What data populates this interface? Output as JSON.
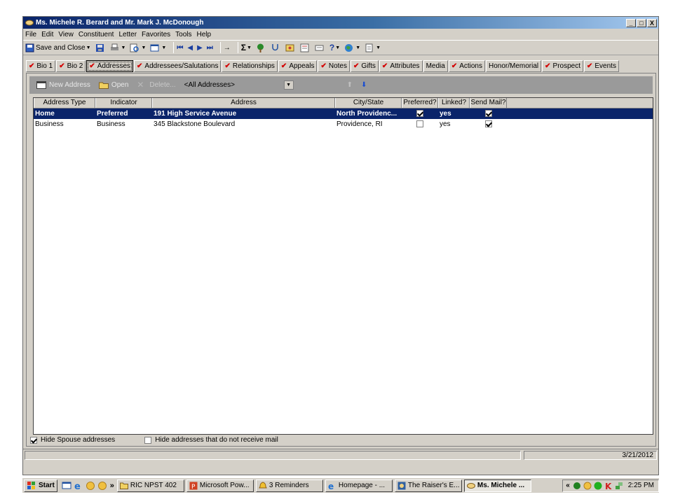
{
  "window": {
    "title": "Ms. Michele R. Berard and Mr. Mark J. McDonough",
    "controls": {
      "minimize": "_",
      "maximize": "□",
      "close": "X"
    }
  },
  "menu": [
    "File",
    "Edit",
    "View",
    "Constituent",
    "Letter",
    "Favorites",
    "Tools",
    "Help"
  ],
  "toolbar": {
    "save_close_label": "Save and Close"
  },
  "tabs": [
    {
      "label": "Bio 1",
      "checked": true
    },
    {
      "label": "Bio 2",
      "checked": true
    },
    {
      "label": "Addresses",
      "checked": true,
      "active": true
    },
    {
      "label": "Addressees/Salutations",
      "checked": true
    },
    {
      "label": "Relationships",
      "checked": true
    },
    {
      "label": "Appeals",
      "checked": true
    },
    {
      "label": "Notes",
      "checked": true
    },
    {
      "label": "Gifts",
      "checked": true
    },
    {
      "label": "Attributes",
      "checked": true
    },
    {
      "label": "Media",
      "checked": false
    },
    {
      "label": "Actions",
      "checked": true
    },
    {
      "label": "Honor/Memorial",
      "checked": false
    },
    {
      "label": "Prospect",
      "checked": true
    },
    {
      "label": "Events",
      "checked": true
    }
  ],
  "address_toolbar": {
    "new_label": "New Address",
    "open_label": "Open",
    "delete_label": "Delete...",
    "filter_value": "<All Addresses>"
  },
  "grid": {
    "columns": [
      "Address Type",
      "Indicator",
      "Address",
      "City/State",
      "Preferred?",
      "Linked?",
      "Send Mail?"
    ],
    "rows": [
      {
        "type": "Home",
        "indicator": "Preferred",
        "address": "191 High Service Avenue",
        "city_state": "North Providenc...",
        "preferred": true,
        "linked": "yes",
        "send_mail": true,
        "selected": true
      },
      {
        "type": "Business",
        "indicator": "Business",
        "address": "345 Blackstone Boulevard",
        "city_state": "Providence, RI",
        "preferred": false,
        "linked": "yes",
        "send_mail": true,
        "selected": false
      }
    ]
  },
  "options": {
    "hide_spouse_label": "Hide Spouse addresses",
    "hide_spouse_checked": true,
    "hide_nomail_label": "Hide addresses that do not receive mail",
    "hide_nomail_checked": false
  },
  "status": {
    "date": "3/21/2012"
  },
  "taskbar": {
    "start_label": "Start",
    "overflow": "»",
    "tasks": [
      {
        "label": "RIC NPST 402",
        "active": false
      },
      {
        "label": "Microsoft Pow...",
        "active": false
      },
      {
        "label": "3 Reminders",
        "active": false
      },
      {
        "label": "Homepage - ...",
        "active": false
      },
      {
        "label": "The Raiser's E...",
        "active": false
      },
      {
        "label": "Ms. Michele ...",
        "active": true
      }
    ],
    "tray_prefix": "«",
    "clock": "2:25 PM"
  },
  "colors": {
    "title_start": "#0a246a",
    "title_end": "#a6caf0",
    "selection": "#0a246a",
    "tab_check": "#d40000"
  }
}
